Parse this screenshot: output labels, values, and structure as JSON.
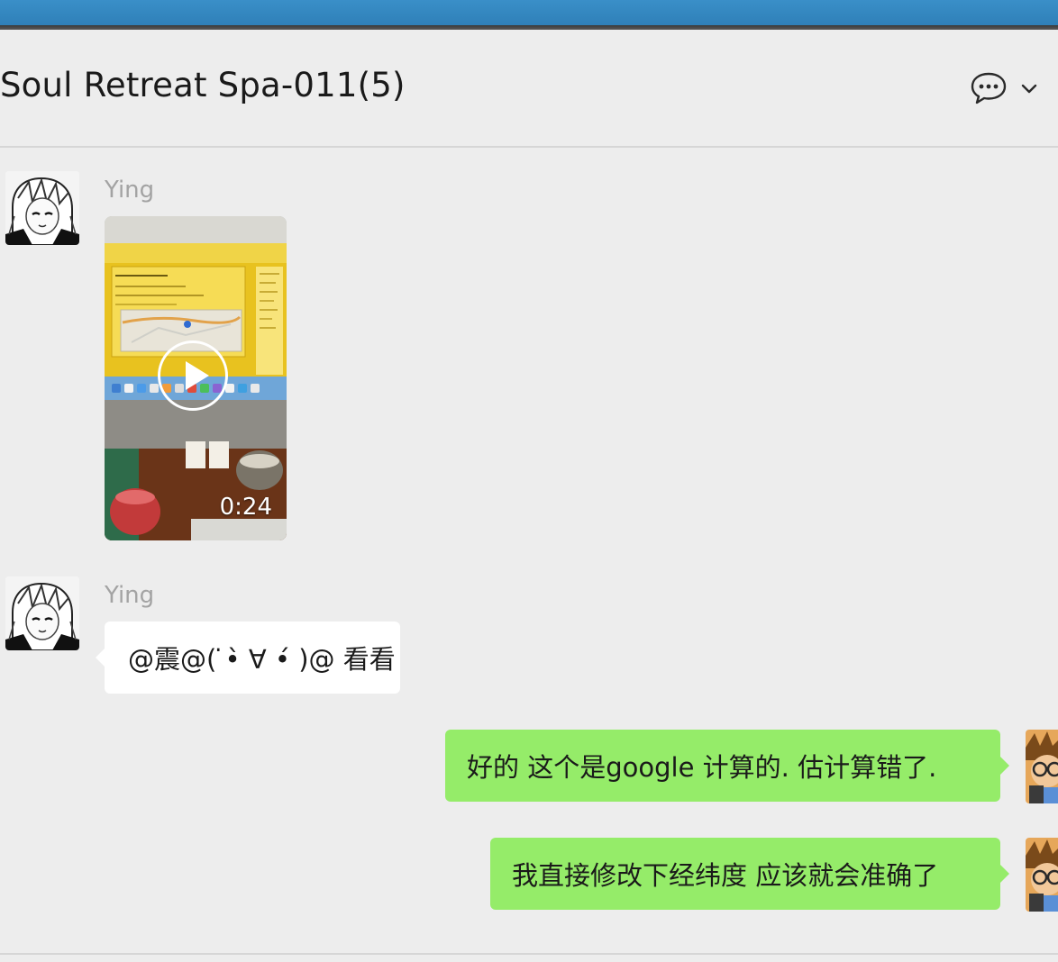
{
  "chat": {
    "title": "Soul Retreat Spa-011(5)"
  },
  "header": {
    "icons": [
      "chat-bubble-icon",
      "chevron-down-icon"
    ]
  },
  "messages": [
    {
      "sender": "Ying",
      "type": "video",
      "duration": "0:24",
      "side": "left"
    },
    {
      "sender": "Ying",
      "type": "text",
      "text": "@震@( ̇•̀ ∀ •́ )@ 看看",
      "side": "left"
    },
    {
      "type": "text",
      "text": "好的 这个是google 计算的. 估计算错了.",
      "side": "right"
    },
    {
      "type": "text",
      "text": "我直接修改下经纬度 应该就会准确了",
      "side": "right"
    }
  ],
  "colors": {
    "background": "#ededed",
    "incoming_bubble": "#ffffff",
    "outgoing_bubble": "#95ec69",
    "sender_name": "#a3a3a3",
    "top_strip": "#3a8fc8"
  }
}
